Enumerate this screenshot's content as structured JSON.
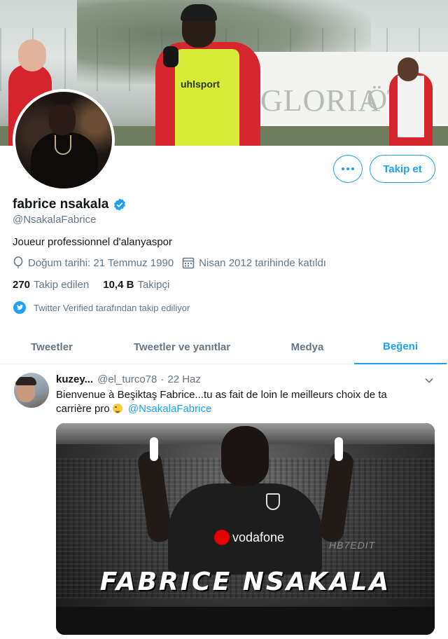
{
  "banner": {
    "wall_text_1": "GLORIA",
    "wall_text_2": "ÖT",
    "vest_text": "uhlsport"
  },
  "profile": {
    "display_name": "fabrice nsakala",
    "handle": "@NsakalaFabrice",
    "bio": "Joueur professionnel d'alanyaspor",
    "birthday": "Doğum tarihi: 21 Temmuz 1990",
    "joined": "Nisan 2012 tarihinde katıldı",
    "following_count": "270",
    "following_label": "Takip edilen",
    "followers_count": "10,4 B",
    "followers_label": "Takipçi",
    "verified_note": "Twitter Verified tarafından takip ediliyor"
  },
  "actions": {
    "follow_label": "Takip et"
  },
  "tabs": [
    {
      "label": "Tweetler"
    },
    {
      "label": "Tweetler ve yanıtlar"
    },
    {
      "label": "Medya"
    },
    {
      "label": "Beğeni",
      "active": true
    }
  ],
  "tweet": {
    "author": "kuzey...",
    "handle": "@el_turco78",
    "date": "22 Haz",
    "separator": "·",
    "text_line1": "Bienvenue à Beşiktaş  Fabrice...tu as fait de loin le meilleurs choix de ta",
    "text_line2": "carrière pro",
    "mention": "@NsakalaFabrice",
    "media": {
      "caption": "FABRICE NSAKALA",
      "sponsor": "vodafone",
      "watermark": "HB7EDIT"
    }
  },
  "colors": {
    "accent": "#1da1f2",
    "text": "#14171a",
    "secondary": "#657786"
  },
  "icons": {
    "verified": "verified-badge-icon",
    "birthday": "balloon-icon",
    "joined": "calendar-icon",
    "verified_note": "twitter-bird-icon",
    "more": "more-dots-icon",
    "caret": "chevron-down-icon"
  }
}
